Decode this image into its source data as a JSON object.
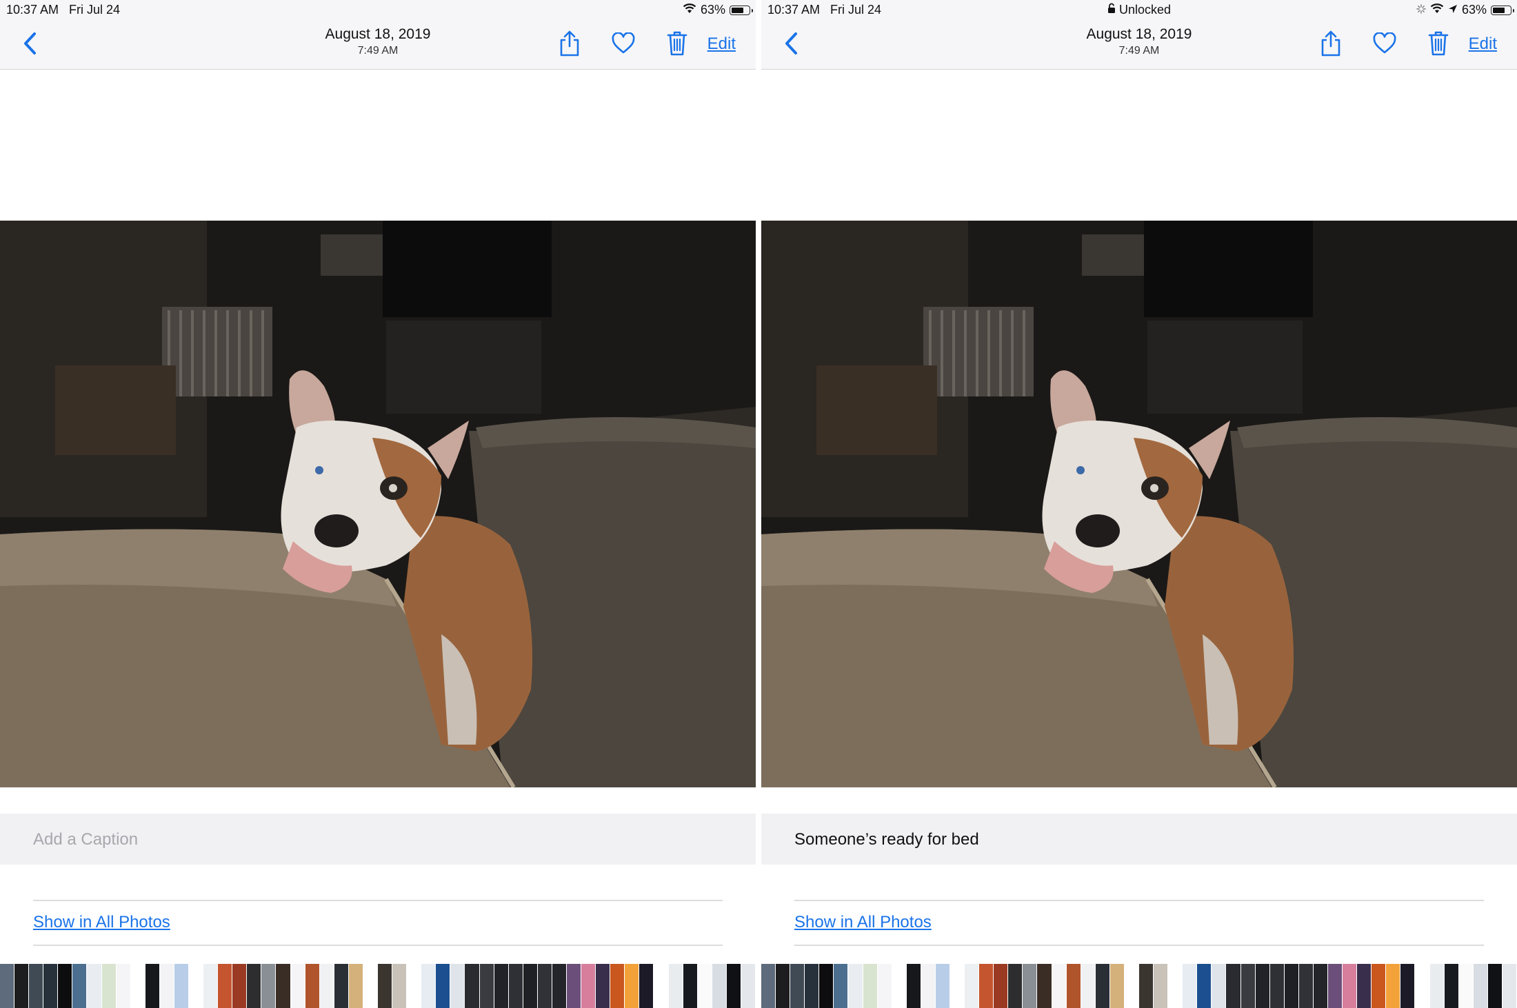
{
  "left": {
    "status": {
      "time": "10:37 AM",
      "date": "Fri Jul 24",
      "battery": "63%"
    },
    "nav": {
      "date": "August 18, 2019",
      "time": "7:49 AM",
      "edit_label": "Edit"
    },
    "caption": {
      "placeholder": "Add a Caption",
      "value": ""
    },
    "show_link": "Show in All Photos"
  },
  "right": {
    "status": {
      "time": "10:37 AM",
      "date": "Fri Jul 24",
      "lock_label": "Unlocked",
      "battery": "63%"
    },
    "nav": {
      "date": "August 18, 2019",
      "time": "7:49 AM",
      "edit_label": "Edit"
    },
    "caption": {
      "value": "Someone’s ready for bed"
    },
    "show_link": "Show in All Photos"
  },
  "icons": {
    "toolbar": [
      "back-chevron-icon",
      "share-icon",
      "heart-icon",
      "trash-icon"
    ],
    "status": [
      "wifi-icon",
      "battery-icon",
      "lock-icon",
      "location-arrow-icon",
      "activity-spinner-icon"
    ]
  },
  "colors": {
    "accent": "#1a73e8",
    "bar_bg": "#f6f6f8",
    "caption_bg": "#f1f1f4"
  },
  "filmstrip": {
    "colors": [
      "#5d6b7c",
      "#1d1d1f",
      "#3f4a55",
      "#26313b",
      "#0d0d0f",
      "#4c6f8f",
      "#e9edf2",
      "#d9e4d0",
      "#f5f5f7",
      "#ffffff",
      "#16181c",
      "#f3f3f5",
      "#b8cde8",
      "#ffffff",
      "#edf0f3",
      "#c4552f",
      "#9b3a23",
      "#2d2d2f",
      "#8a8f95",
      "#3a2d26",
      "#f5f5f7",
      "#b0542c",
      "#f0f1f3",
      "#2a2f36",
      "#d4b07b",
      "#ffffff",
      "#3b3530",
      "#c8c2b8",
      "#ffffff",
      "#e6ecf2",
      "#1b4f8f",
      "#dfe4ea",
      "#2a2b30",
      "#3a3b40",
      "#222328",
      "#2f3036",
      "#1f2025",
      "#313238",
      "#24252a",
      "#6b4f7a",
      "#d67e9c",
      "#3a2e4d",
      "#c9571e",
      "#f3a23a",
      "#1c1a26",
      "#ffffff",
      "#e9ecef",
      "#171a1f",
      "#fafafa",
      "#d8dde3",
      "#0f1114",
      "#e4e8ec"
    ]
  }
}
